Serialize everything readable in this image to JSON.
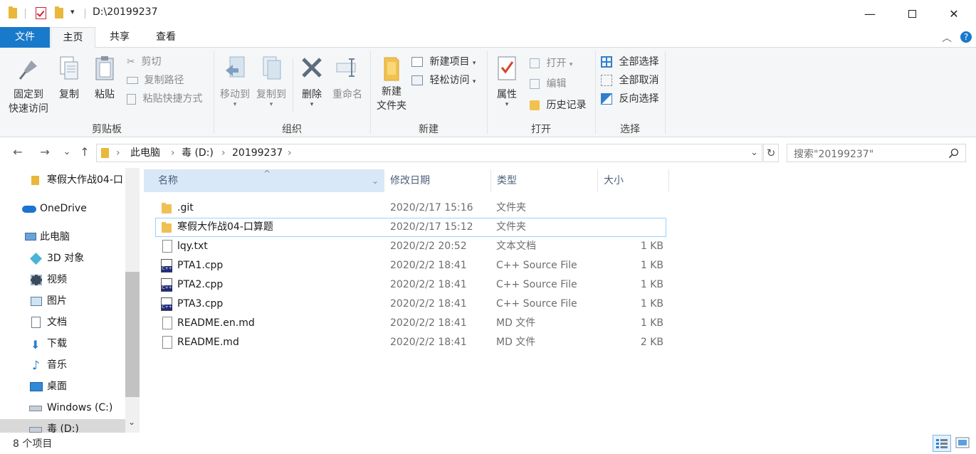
{
  "window": {
    "title": "D:\\20199237",
    "minimize_glyph": "—",
    "maximize_glyph": "☐",
    "close_glyph": "✕"
  },
  "qat": {
    "dropdown_glyph": "▾"
  },
  "ribbon_tabs": [
    {
      "label": "文件"
    },
    {
      "label": "主页"
    },
    {
      "label": "共享"
    },
    {
      "label": "查看"
    }
  ],
  "ribbon_collapse_glyph": "︿",
  "help_glyph": "?",
  "ribbon": {
    "clipboard": {
      "label": "剪贴板",
      "pin_line1": "固定到",
      "pin_line2": "快速访问",
      "copy": "复制",
      "paste": "粘贴",
      "cut": "剪切",
      "copy_path": "复制路径",
      "paste_shortcut": "粘贴快捷方式"
    },
    "organize": {
      "label": "组织",
      "move_to": "移动到",
      "copy_to": "复制到",
      "delete": "删除",
      "rename": "重命名"
    },
    "new": {
      "label": "新建",
      "new_folder_line1": "新建",
      "new_folder_line2": "文件夹",
      "new_item": "新建项目",
      "easy_access": "轻松访问"
    },
    "open": {
      "label": "打开",
      "properties": "属性",
      "open": "打开",
      "edit": "编辑",
      "history": "历史记录"
    },
    "select": {
      "label": "选择",
      "select_all": "全部选择",
      "select_none": "全部取消",
      "invert": "反向选择"
    }
  },
  "nav": {
    "back": "←",
    "forward": "→",
    "recent": "⌄",
    "up": "↑",
    "breadcrumb": [
      "此电脑",
      "毒 (D:)",
      "20199237"
    ],
    "breadcrumb_sep": "›",
    "dropdown": "⌄",
    "refresh": "↻",
    "search_placeholder": "搜索\"20199237\""
  },
  "sidebar": {
    "items": [
      {
        "label": "寒假大作战04-口",
        "icon": "folder-icon"
      },
      {
        "label": "OneDrive",
        "icon": "onedrive-icon"
      },
      {
        "label": "此电脑",
        "icon": "computer-icon"
      },
      {
        "label": "3D 对象",
        "icon": "3d-objects-icon"
      },
      {
        "label": "视频",
        "icon": "videos-icon"
      },
      {
        "label": "图片",
        "icon": "pictures-icon"
      },
      {
        "label": "文档",
        "icon": "documents-icon"
      },
      {
        "label": "下载",
        "icon": "downloads-icon"
      },
      {
        "label": "音乐",
        "icon": "music-icon"
      },
      {
        "label": "桌面",
        "icon": "desktop-icon"
      },
      {
        "label": "Windows (C:)",
        "icon": "drive-c-icon"
      },
      {
        "label": "毒 (D:)",
        "icon": "drive-d-icon"
      }
    ],
    "scroll_down_glyph": "⌄"
  },
  "columns": {
    "name": "名称",
    "date": "修改日期",
    "type": "类型",
    "size": "大小",
    "sort_glyph": "^",
    "filter_glyph": "⌄"
  },
  "files": [
    {
      "name": ".git",
      "date": "2020/2/17 15:16",
      "type": "文件夹",
      "size": "",
      "icon": "folder-icon"
    },
    {
      "name": "寒假大作战04-口算题",
      "date": "2020/2/17 15:12",
      "type": "文件夹",
      "size": "",
      "icon": "folder-icon"
    },
    {
      "name": "lqy.txt",
      "date": "2020/2/2 20:52",
      "type": "文本文档",
      "size": "1 KB",
      "icon": "text-file-icon"
    },
    {
      "name": "PTA1.cpp",
      "date": "2020/2/2 18:41",
      "type": "C++ Source File",
      "size": "1 KB",
      "icon": "cpp-file-icon"
    },
    {
      "name": "PTA2.cpp",
      "date": "2020/2/2 18:41",
      "type": "C++ Source File",
      "size": "1 KB",
      "icon": "cpp-file-icon"
    },
    {
      "name": "PTA3.cpp",
      "date": "2020/2/2 18:41",
      "type": "C++ Source File",
      "size": "1 KB",
      "icon": "cpp-file-icon"
    },
    {
      "name": "README.en.md",
      "date": "2020/2/2 18:41",
      "type": "MD 文件",
      "size": "1 KB",
      "icon": "file-icon"
    },
    {
      "name": "README.md",
      "date": "2020/2/2 18:41",
      "type": "MD 文件",
      "size": "2 KB",
      "icon": "file-icon"
    }
  ],
  "status": {
    "item_count": "8 个项目"
  },
  "colors": {
    "accent": "#1979ca",
    "selection": "#d8e8f8",
    "focus_border": "#99d1ff"
  }
}
